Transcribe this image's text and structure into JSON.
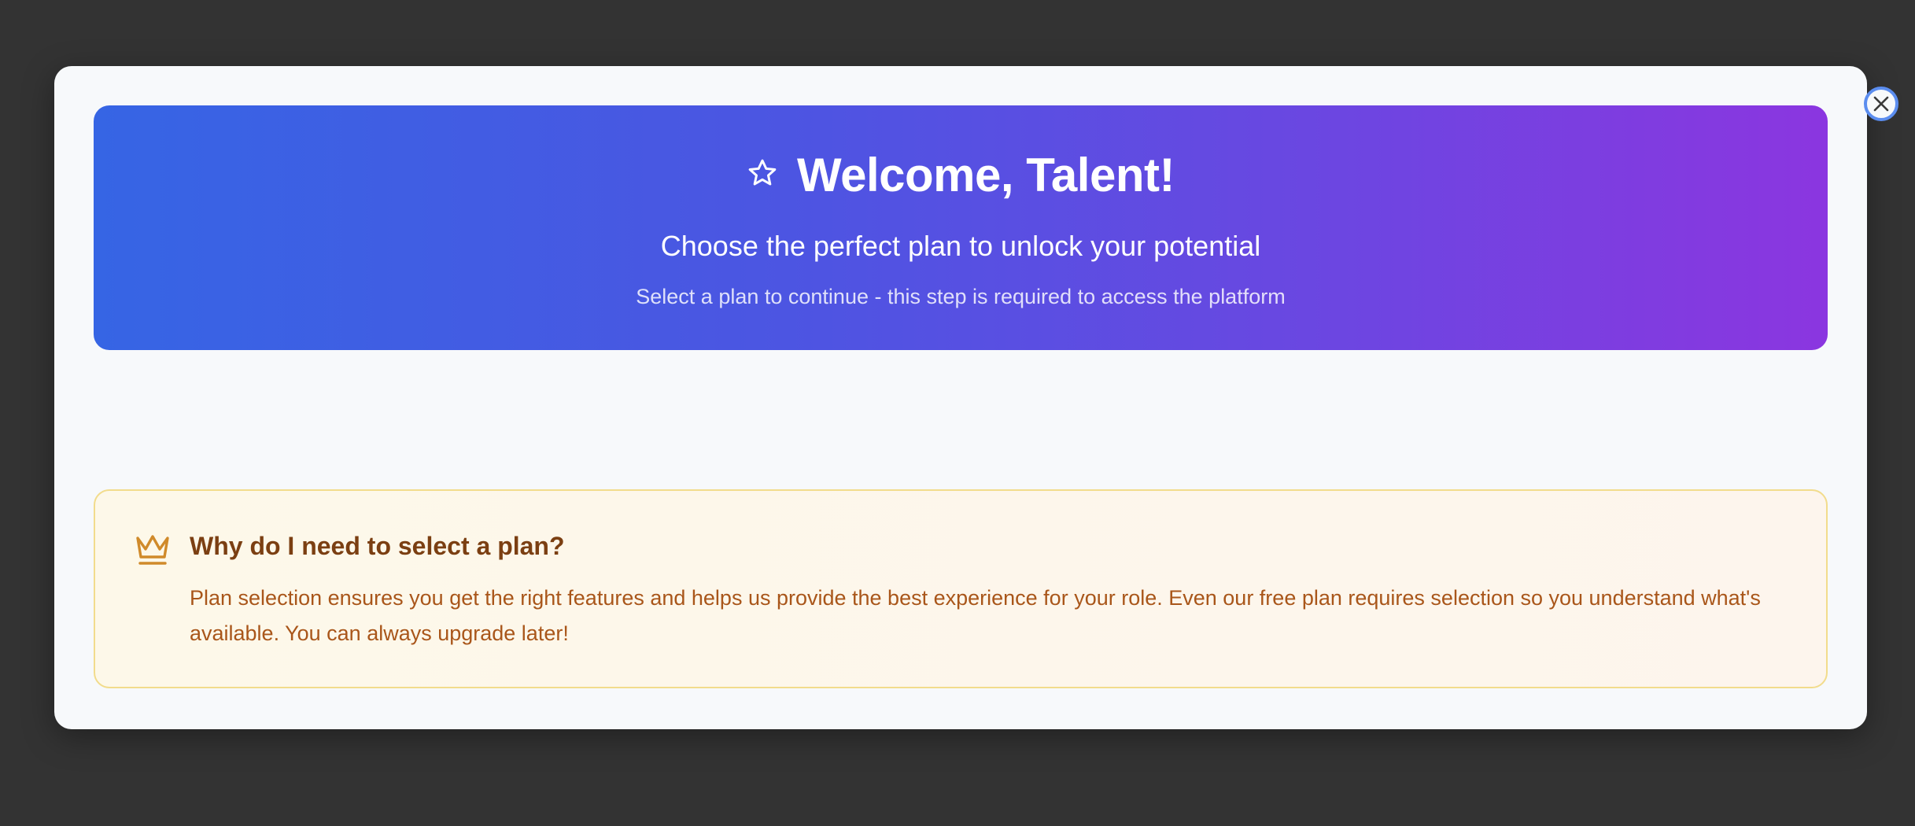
{
  "modal": {
    "close_icon": "close-icon",
    "hero": {
      "icon": "star-icon",
      "title": "Welcome, Talent!",
      "subtitle": "Choose the perfect plan to unlock your potential",
      "note": "Select a plan to continue - this step is required to access the platform"
    },
    "info": {
      "icon": "crown-icon",
      "title": "Why do I need to select a plan?",
      "text": "Plan selection ensures you get the right features and helps us provide the best experience for your role. Even our free plan requires selection so you understand what's available. You can always upgrade later!"
    }
  },
  "colors": {
    "backdrop": "#333333",
    "modal_bg": "#f7f9fb",
    "hero_gradient_start": "#3665e4",
    "hero_gradient_end": "#8b36e0",
    "info_border": "#f2dc8c",
    "info_title": "#7b3f12",
    "info_text": "#a9561a",
    "crown": "#d08a2a",
    "close_ring": "#5b8def"
  }
}
